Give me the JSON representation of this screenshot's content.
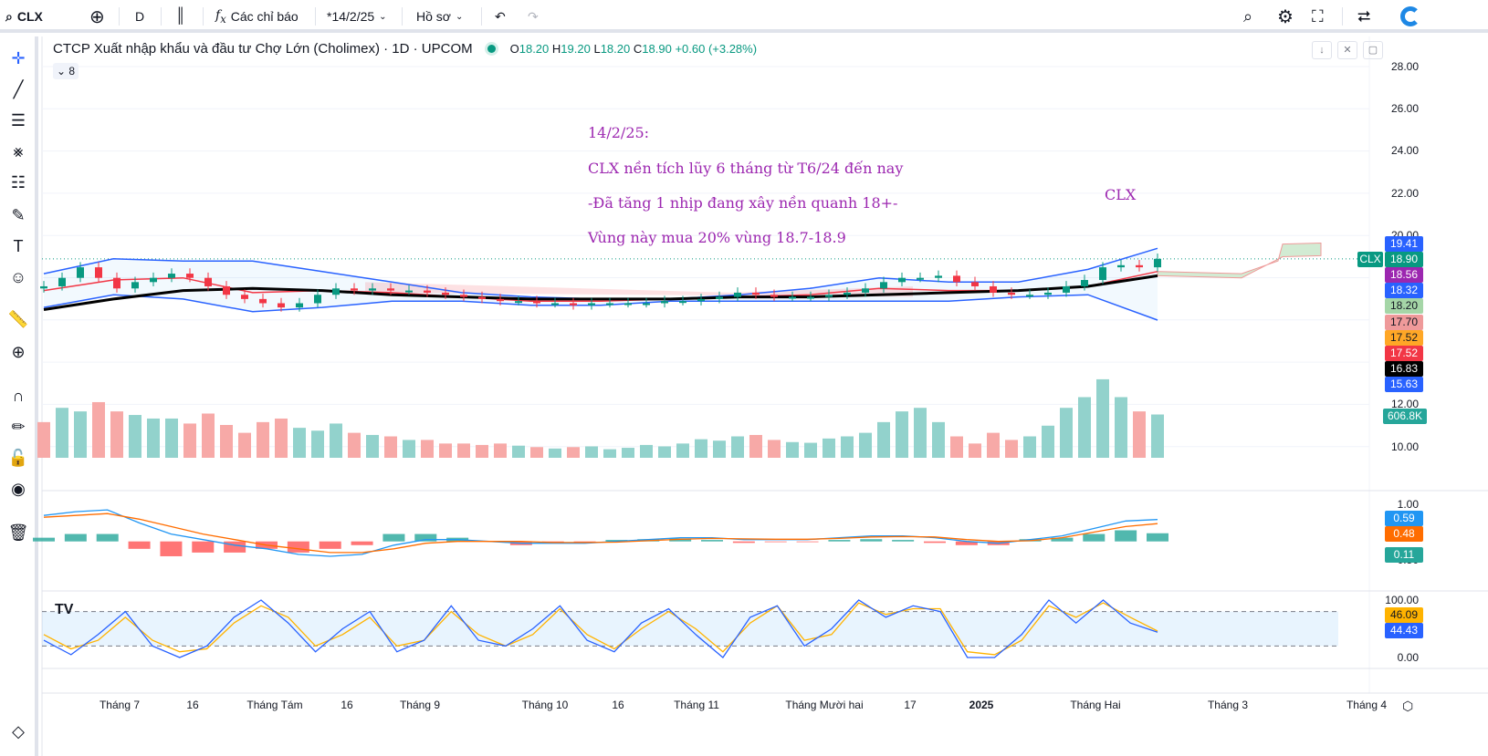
{
  "toolbar": {
    "symbol": "CLX",
    "interval": "D",
    "indicators_label": "Các chỉ báo",
    "date_label": "*14/2/25",
    "profile_label": "Hồ sơ"
  },
  "legend": {
    "title": "CTCP Xuất nhập khẩu và đầu tư Chợ Lớn (Cholimex) · 1D · UPCOM",
    "o_label": "O",
    "o": "18.20",
    "h_label": "H",
    "h": "19.20",
    "l_label": "L",
    "l": "18.20",
    "c_label": "C",
    "c": "18.90",
    "change": "+0.60 (+3.28%)",
    "collapse_count": "8"
  },
  "annotations": {
    "line1": "14/2/25:",
    "line2": "CLX nền tích lũy 6 tháng từ T6/24 đến nay",
    "line3": "-Đã tăng 1 nhịp đang xây nền quanh 18+-",
    "line4": "Vùng này mua 20% vùng 18.7-18.9",
    "symbol_mark": "CLX"
  },
  "price_axis": [
    "28.00",
    "26.00",
    "24.00",
    "22.00",
    "20.00",
    "12.00",
    "10.00"
  ],
  "price_tags": [
    {
      "text": "19.41",
      "color": "#2962ff",
      "fg": "#ffffff"
    },
    {
      "text": "18.90",
      "color": "#089981",
      "fg": "#ffffff"
    },
    {
      "text": "18.56",
      "color": "#9c27b0",
      "fg": "#ffffff"
    },
    {
      "text": "18.32",
      "color": "#2962ff",
      "fg": "#ffffff"
    },
    {
      "text": "18.20",
      "color": "#a5d6a7",
      "fg": "#131722"
    },
    {
      "text": "17.70",
      "color": "#ef9a9a",
      "fg": "#131722"
    },
    {
      "text": "17.52",
      "color": "#ffa726",
      "fg": "#131722"
    },
    {
      "text": "17.52",
      "color": "#f23645",
      "fg": "#ffffff"
    },
    {
      "text": "16.83",
      "color": "#000000",
      "fg": "#ffffff"
    },
    {
      "text": "15.63",
      "color": "#2962ff",
      "fg": "#ffffff"
    }
  ],
  "symbol_tag": "CLX",
  "volume_tag": "606.8K",
  "macd_axis": [
    "1.00",
    "-0.50"
  ],
  "macd_tags": [
    {
      "text": "0.59",
      "color": "#2196f3"
    },
    {
      "text": "0.48",
      "color": "#ff6d00"
    },
    {
      "text": "0.11",
      "color": "#26a69a"
    }
  ],
  "stoch_axis": [
    "100.00",
    "0.00"
  ],
  "stoch_tags": [
    {
      "text": "46.09",
      "color": "#ffb300",
      "fg": "#131722"
    },
    {
      "text": "44.43",
      "color": "#2962ff",
      "fg": "#ffffff"
    }
  ],
  "time_axis": [
    "Tháng 7",
    "16",
    "Tháng Tám",
    "16",
    "Tháng 9",
    "Tháng 10",
    "16",
    "Tháng 11",
    "Tháng Mười hai",
    "17",
    "2025",
    "Tháng Hai",
    "Tháng 3",
    "Tháng 4"
  ],
  "chart_data": {
    "type": "line",
    "closes": [
      17.6,
      18.0,
      18.5,
      18.0,
      17.5,
      17.8,
      18.0,
      18.2,
      18.0,
      17.6,
      17.2,
      17.0,
      16.8,
      16.6,
      16.8,
      17.2,
      17.5,
      17.4,
      17.5,
      17.4,
      17.4,
      17.3,
      17.2,
      17.1,
      17.0,
      16.9,
      16.9,
      16.8,
      16.8,
      16.7,
      16.8,
      16.8,
      16.8,
      16.8,
      16.9,
      16.9,
      17.0,
      17.1,
      17.3,
      17.2,
      17.1,
      17.1,
      17.1,
      17.2,
      17.3,
      17.5,
      17.8,
      18.0,
      18.0,
      18.1,
      17.8,
      17.6,
      17.3,
      17.2,
      17.2,
      17.3,
      17.6,
      17.9,
      18.5,
      18.6,
      18.5,
      18.9
    ],
    "bb_upper": [
      18.2,
      18.9,
      18.8,
      18.8,
      18.3,
      17.8,
      17.3,
      17.1,
      17.0,
      17.0,
      17.2,
      17.5,
      18.0,
      17.8,
      17.8,
      18.4,
      19.4
    ],
    "bb_lower": [
      16.6,
      17.2,
      17.0,
      16.4,
      16.6,
      16.9,
      16.9,
      16.7,
      16.7,
      16.9,
      16.9,
      16.9,
      16.9,
      16.9,
      17.1,
      17.2,
      16.0
    ],
    "sma_red": [
      17.4,
      17.9,
      18.0,
      17.3,
      17.4,
      17.3,
      17.1,
      16.9,
      16.9,
      17.0,
      17.1,
      17.2,
      17.5,
      17.4,
      17.4,
      17.6,
      18.3
    ],
    "sma_black": [
      16.5,
      17.0,
      17.4,
      17.5,
      17.4,
      17.2,
      17.1,
      17.0,
      17.0,
      17.0,
      17.1,
      17.1,
      17.2,
      17.3,
      17.4,
      17.6,
      18.1
    ],
    "volume_k": [
      500,
      700,
      650,
      780,
      650,
      600,
      550,
      550,
      480,
      620,
      460,
      350,
      500,
      550,
      420,
      380,
      480,
      350,
      320,
      300,
      250,
      250,
      200,
      200,
      180,
      200,
      170,
      150,
      130,
      150,
      160,
      120,
      140,
      180,
      160,
      200,
      260,
      240,
      300,
      320,
      250,
      220,
      210,
      270,
      300,
      350,
      500,
      650,
      700,
      500,
      300,
      200,
      350,
      250,
      300,
      450,
      700,
      850,
      1100,
      850,
      650,
      606.8
    ],
    "macd": [
      0.7,
      0.8,
      0.85,
      0.5,
      0.2,
      0.05,
      -0.1,
      -0.2,
      -0.35,
      -0.4,
      -0.35,
      -0.1,
      0.05,
      0.05,
      0.0,
      -0.05,
      -0.05,
      -0.05,
      0.0,
      0.05,
      0.1,
      0.1,
      0.05,
      0.05,
      0.05,
      0.1,
      0.15,
      0.15,
      0.1,
      0.0,
      -0.05,
      0.05,
      0.15,
      0.35,
      0.55,
      0.59
    ],
    "macd_signal": [
      0.65,
      0.7,
      0.75,
      0.6,
      0.4,
      0.2,
      0.05,
      -0.1,
      -0.2,
      -0.3,
      -0.3,
      -0.2,
      -0.05,
      0.0,
      0.0,
      0.0,
      -0.03,
      -0.03,
      -0.02,
      0.02,
      0.06,
      0.08,
      0.07,
      0.06,
      0.06,
      0.08,
      0.12,
      0.13,
      0.12,
      0.05,
      0.0,
      0.02,
      0.1,
      0.25,
      0.4,
      0.48
    ],
    "stoch_k": [
      30,
      5,
      40,
      80,
      20,
      0,
      20,
      70,
      100,
      60,
      10,
      50,
      80,
      10,
      30,
      90,
      30,
      20,
      50,
      90,
      30,
      10,
      60,
      85,
      40,
      0,
      70,
      90,
      20,
      50,
      100,
      70,
      90,
      80,
      0,
      0,
      40,
      100,
      60,
      100,
      60,
      44
    ],
    "stoch_d": [
      40,
      15,
      30,
      70,
      30,
      10,
      15,
      60,
      90,
      70,
      20,
      40,
      70,
      20,
      30,
      80,
      40,
      20,
      40,
      85,
      40,
      15,
      50,
      80,
      50,
      10,
      60,
      90,
      30,
      40,
      95,
      75,
      85,
      85,
      10,
      5,
      30,
      90,
      70,
      95,
      70,
      46
    ],
    "price_range": [
      9.6,
      28.5
    ],
    "macd_range": [
      -0.5,
      1.0
    ],
    "stoch_range": [
      0,
      100
    ]
  }
}
